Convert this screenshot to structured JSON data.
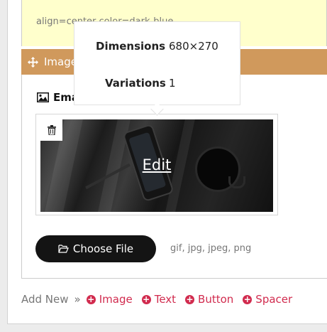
{
  "block_above": {
    "text": "align=center color=dark-blue"
  },
  "image_block": {
    "title": "Image",
    "status_dot": "•",
    "email_label": "Ema",
    "edit_label": "Edit"
  },
  "tooltip": {
    "rows": [
      {
        "label": "Dimensions",
        "value": "680×270"
      },
      {
        "label": "Variations",
        "value": "1"
      }
    ]
  },
  "upload": {
    "button_label": "Choose File",
    "file_types": "gif, jpg, jpeg, png"
  },
  "add_new": {
    "label": "Add New",
    "separator": "»",
    "items": [
      {
        "label": "Image"
      },
      {
        "label": "Text"
      },
      {
        "label": "Button"
      },
      {
        "label": "Spacer"
      }
    ]
  },
  "colors": {
    "header_bar": "#d0995c",
    "add_link": "#d12b4e",
    "note_background": "#ffffcc"
  }
}
